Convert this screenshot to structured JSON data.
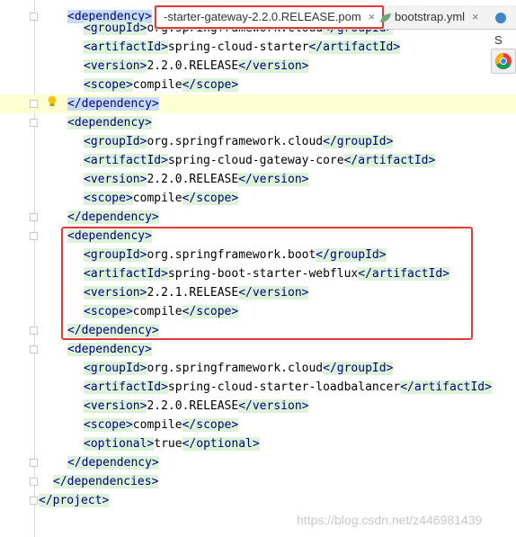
{
  "tabs": [
    {
      "label": "-starter-gateway-2.2.0.RELEASE.pom",
      "active": true
    },
    {
      "label": "bootstrap.yml",
      "active": false
    },
    {
      "label": "S",
      "active": false
    }
  ],
  "close_glyph": "×",
  "code": {
    "l0": "<dependency>",
    "l1a": "<groupId>",
    "l1b": "org.springframework.cloud",
    "l1c": "</groupId>",
    "l2a": "<artifactId>",
    "l2b": "spring-cloud-starter",
    "l2c": "</artifactId>",
    "l3a": "<version>",
    "l3b": "2.2.0.RELEASE",
    "l3c": "</version>",
    "l4a": "<scope>",
    "l4b": "compile",
    "l4c": "</scope>",
    "l5": "</dependency>",
    "l6": "<dependency>",
    "l7a": "<groupId>",
    "l7b": "org.springframework.cloud",
    "l7c": "</groupId>",
    "l8a": "<artifactId>",
    "l8b": "spring-cloud-gateway-core",
    "l8c": "</artifactId>",
    "l9a": "<version>",
    "l9b": "2.2.0.RELEASE",
    "l9c": "</version>",
    "l10a": "<scope>",
    "l10b": "compile",
    "l10c": "</scope>",
    "l11": "</dependency>",
    "l12": "<dependency>",
    "l13a": "<groupId>",
    "l13b": "org.springframework.boot",
    "l13c": "</groupId>",
    "l14a": "<artifactId>",
    "l14b": "spring-boot-starter-webflux",
    "l14c": "</artifactId>",
    "l15a": "<version>",
    "l15b": "2.2.1.RELEASE",
    "l15c": "</version>",
    "l16a": "<scope>",
    "l16b": "compile",
    "l16c": "</scope>",
    "l17": "</dependency>",
    "l18": "<dependency>",
    "l19a": "<groupId>",
    "l19b": "org.springframework.cloud",
    "l19c": "</groupId>",
    "l20a": "<artifactId>",
    "l20b": "spring-cloud-starter-loadbalancer",
    "l20c": "</artifactId>",
    "l21a": "<version>",
    "l21b": "2.2.0.RELEASE",
    "l21c": "</version>",
    "l22a": "<scope>",
    "l22b": "compile",
    "l22c": "</scope>",
    "l23a": "<optional>",
    "l23b": "true",
    "l23c": "</optional>",
    "l24": "</dependency>",
    "l25": "</dependencies>",
    "l26": "</project>"
  },
  "watermark": "https://blog.csdn.net/z446981439",
  "colors": {
    "tag": "#000080",
    "highlight_box": "#e53935",
    "tag_bg": "#ddf3d9"
  }
}
